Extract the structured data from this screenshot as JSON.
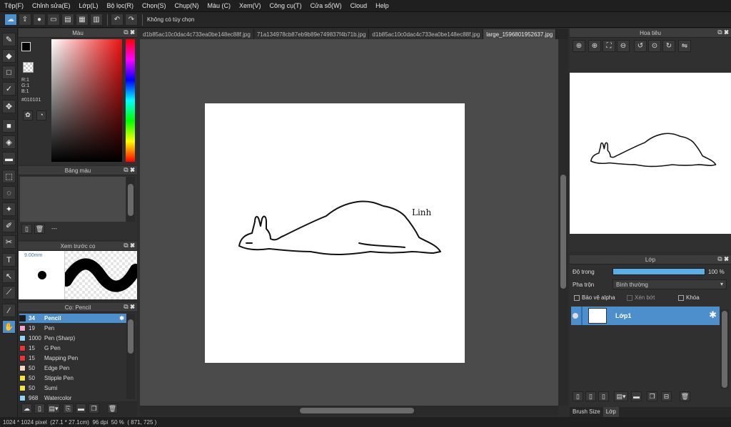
{
  "menu": [
    "Tệp(F)",
    "Chỉnh sửa(E)",
    "Lớp(L)",
    "Bộ lọc(R)",
    "Chọn(S)",
    "Chụp(N)",
    "Màu (C)",
    "Xem(V)",
    "Công cụ(T)",
    "Cửa sổ(W)",
    "Cloud",
    "Help"
  ],
  "toolbar": {
    "selection_text": "Không có tùy chọn"
  },
  "color_panel": {
    "title": "Màu",
    "r": "R:1",
    "g": "G:1",
    "b": "B:1",
    "hex": "#010101",
    "fg_color": "#010101",
    "bg_color": "#8888ee"
  },
  "palette_panel": {
    "title": "Bảng màu",
    "value": "---"
  },
  "brush_preview": {
    "title": "Xem trước cọ",
    "size": "9.00mm"
  },
  "brush_panel": {
    "title": "Cọ: Pencil",
    "items": [
      {
        "size": "34",
        "name": "Pencil",
        "color": "#1a1a1a"
      },
      {
        "size": "19",
        "name": "Pen",
        "color": "#f7a3c9"
      },
      {
        "size": "1000",
        "name": "Pen (Sharp)",
        "color": "#8fd4f5"
      },
      {
        "size": "15",
        "name": "G Pen",
        "color": "#e8343a"
      },
      {
        "size": "15",
        "name": "Mapping Pen",
        "color": "#e8343a"
      },
      {
        "size": "50",
        "name": "Edge Pen",
        "color": "#f4d7c5"
      },
      {
        "size": "50",
        "name": "Stipple Pen",
        "color": "#f0e63a"
      },
      {
        "size": "50",
        "name": "Sumi",
        "color": "#f0e63a"
      },
      {
        "size": "968",
        "name": "Watercolor",
        "color": "#8fd4f5"
      }
    ]
  },
  "tabs": [
    "d1b85ac10c0dac4c733ea0be148ec88f.jpg",
    "71a134978cb87eb9b89e749837f4b71b.jpg",
    "d1b85ac10c0dac4c733ea0be148ec88f.jpg",
    "large_1596801952637.jpg"
  ],
  "artwork": {
    "label": "Linh"
  },
  "navigator": {
    "title": "Hoa tiêu"
  },
  "layer_panel": {
    "title": "Lớp",
    "opacity_label": "Độ trong",
    "opacity_value": "100 %",
    "opacity": 1.0,
    "blend_label": "Pha trộn",
    "blend_value": "Bình thường",
    "protect_alpha": "Bảo vệ alpha",
    "clipping": "Xén bớt",
    "lock": "Khóa",
    "layer_name": "Lớp1"
  },
  "bottom_tabs": [
    "Brush Size",
    "Lớp"
  ],
  "status": {
    "size": "1024 * 1024 pixel",
    "cm": "(27.1 * 27.1cm)",
    "dpi": "96 dpi",
    "zoom": "50 %",
    "coords": "( 871, 725 )"
  }
}
